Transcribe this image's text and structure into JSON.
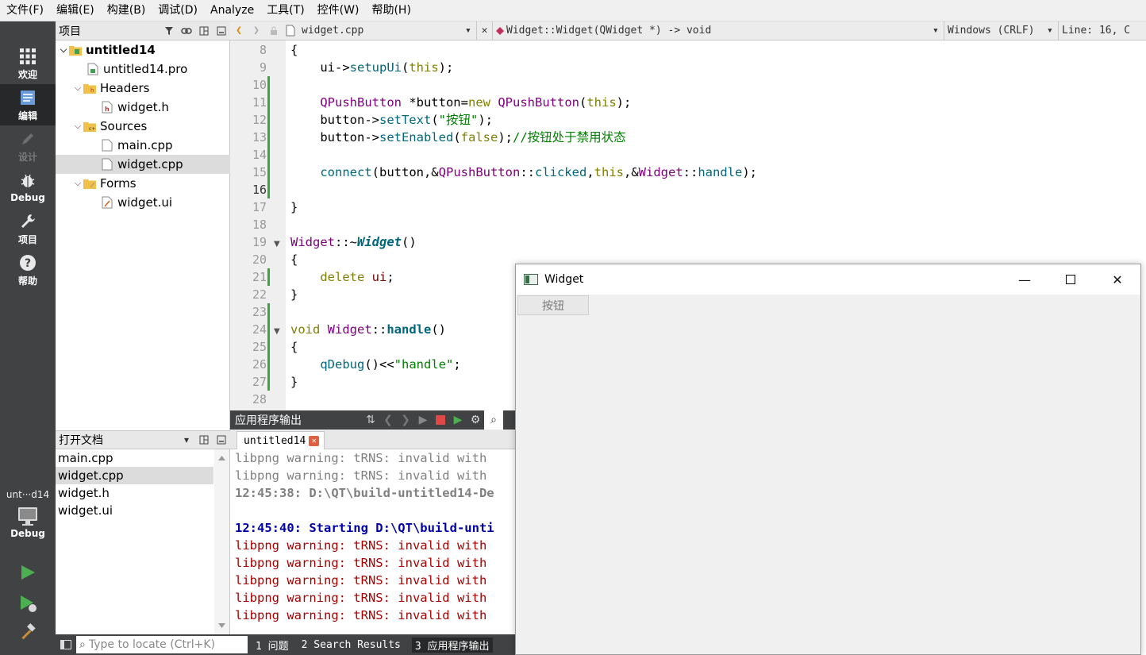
{
  "menu": [
    "文件(F)",
    "编辑(E)",
    "构建(B)",
    "调试(D)",
    "Analyze",
    "工具(T)",
    "控件(W)",
    "帮助(H)"
  ],
  "modes": [
    {
      "label": "欢迎",
      "icon": "grid-icon"
    },
    {
      "label": "编辑",
      "icon": "document-icon"
    },
    {
      "label": "设计",
      "icon": "pencil-icon"
    },
    {
      "label": "Debug",
      "icon": "bug-icon"
    },
    {
      "label": "项目",
      "icon": "wrench-icon"
    },
    {
      "label": "帮助",
      "icon": "help-icon"
    }
  ],
  "kit": {
    "name": "unt···d14",
    "mode": "Debug"
  },
  "project_pane": {
    "title": "项目",
    "tree": [
      {
        "label": "untitled14",
        "type": "project"
      },
      {
        "label": "untitled14.pro",
        "type": "pro-file"
      },
      {
        "label": "Headers",
        "type": "folder"
      },
      {
        "label": "widget.h",
        "type": "header-file"
      },
      {
        "label": "Sources",
        "type": "folder"
      },
      {
        "label": "main.cpp",
        "type": "source-file"
      },
      {
        "label": "widget.cpp",
        "type": "source-file"
      },
      {
        "label": "Forms",
        "type": "folder"
      },
      {
        "label": "widget.ui",
        "type": "form-file"
      }
    ]
  },
  "open_docs": {
    "title": "打开文档",
    "items": [
      "main.cpp",
      "widget.cpp",
      "widget.h",
      "widget.ui"
    ]
  },
  "editor_toolbar": {
    "file": "widget.cpp",
    "symbol": "Widget::Widget(QWidget *) -> void",
    "line_ending": "Windows (CRLF)",
    "position": "Line: 16, C"
  },
  "code": {
    "line_numbers": [
      "8",
      "9",
      "10",
      "11",
      "12",
      "13",
      "14",
      "15",
      "16",
      "17",
      "18",
      "19",
      "20",
      "21",
      "22",
      "23",
      "24",
      "25",
      "26",
      "27",
      "28"
    ],
    "current_line": "16"
  },
  "output": {
    "header": "应用程序输出",
    "tab": "untitled14",
    "lines": [
      {
        "text": "libpng warning: tRNS: invalid with",
        "style": "gray"
      },
      {
        "text": "libpng warning: tRNS: invalid with",
        "style": "gray"
      },
      {
        "text": "12:45:38: D:\\QT\\build-untitled14-De",
        "style": "gray-b"
      },
      {
        "text": "",
        "style": "gray"
      },
      {
        "text": "12:45:40: Starting D:\\QT\\build-unti",
        "style": "blue-b"
      },
      {
        "text": "libpng warning: tRNS: invalid with",
        "style": "red"
      },
      {
        "text": "libpng warning: tRNS: invalid with",
        "style": "red"
      },
      {
        "text": "libpng warning: tRNS: invalid with",
        "style": "red"
      },
      {
        "text": "libpng warning: tRNS: invalid with",
        "style": "red"
      },
      {
        "text": "libpng warning: tRNS: invalid with",
        "style": "red"
      }
    ]
  },
  "statusbar": {
    "locator_placeholder": "Type to locate (Ctrl+K)",
    "tabs": [
      "1 问题",
      "2 Search Results",
      "3 应用程序输出"
    ]
  },
  "widget_window": {
    "title": "Widget",
    "button_label": "按钮"
  },
  "colors": {
    "accent": "#404244",
    "keyword": "#808000",
    "function": "#00677c",
    "type": "#800080",
    "string": "#008000",
    "output_blue": "#0000aa",
    "output_red": "#aa0000"
  }
}
